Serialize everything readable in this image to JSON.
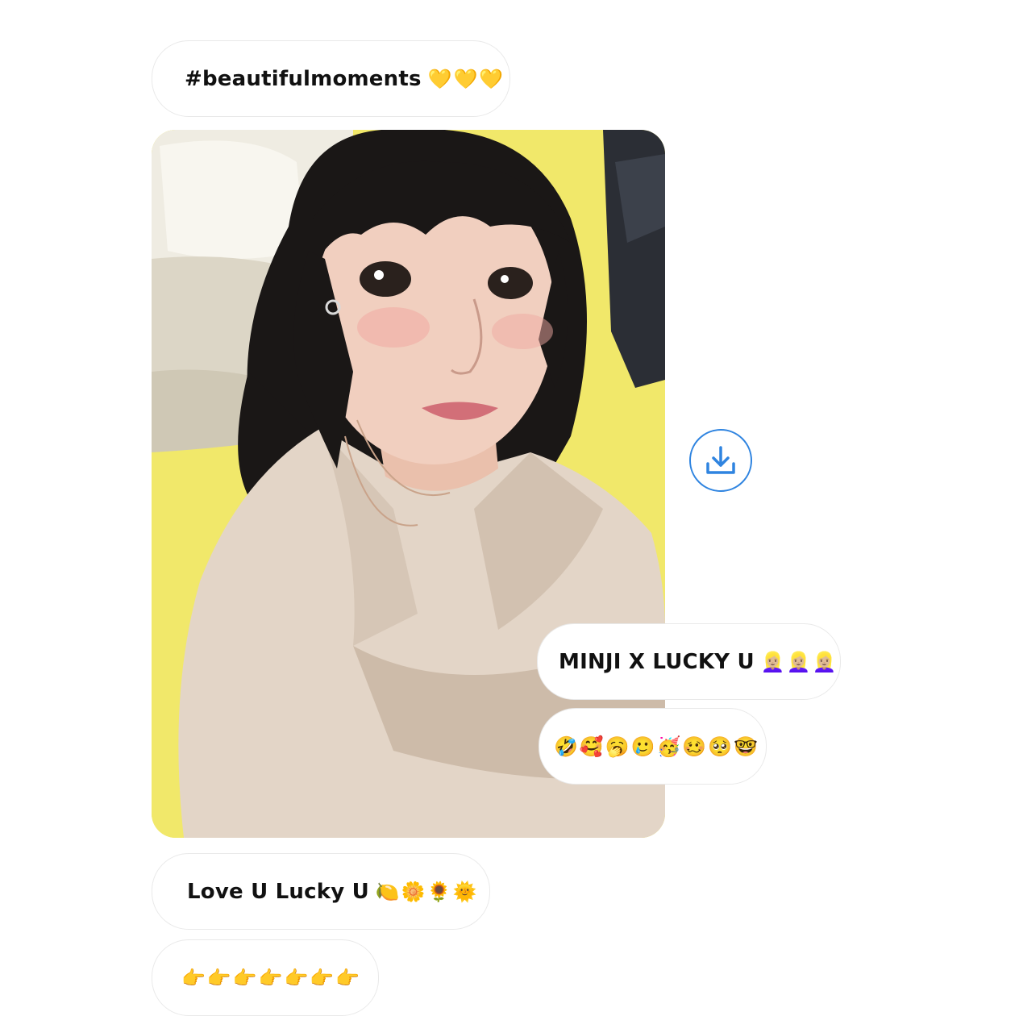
{
  "messages": {
    "hashtag": {
      "text": "#beautifulmoments",
      "emoji": "💛💛💛"
    },
    "photo": {
      "alt_icon": "selfie-photo"
    },
    "caption": {
      "text": "MINJI X LUCKY U",
      "emoji": "👱🏼‍♀️👱🏼‍♀️👱🏼‍♀️"
    },
    "reaction_emojis": {
      "emoji": "🤣🥰🥱🥲🥳🥴🥺🤓"
    },
    "love_message": {
      "text": "Love U Lucky U",
      "emoji": "🍋🌼🌻🌞"
    },
    "pointing_emojis": {
      "emoji": "👉👉👉👉👉👉👉"
    }
  },
  "actions": {
    "download_icon": "download-icon"
  },
  "colors": {
    "accent": "#2f84e0",
    "bubble_border": "#e9e9e9",
    "photo_background": "#f1e86a"
  }
}
